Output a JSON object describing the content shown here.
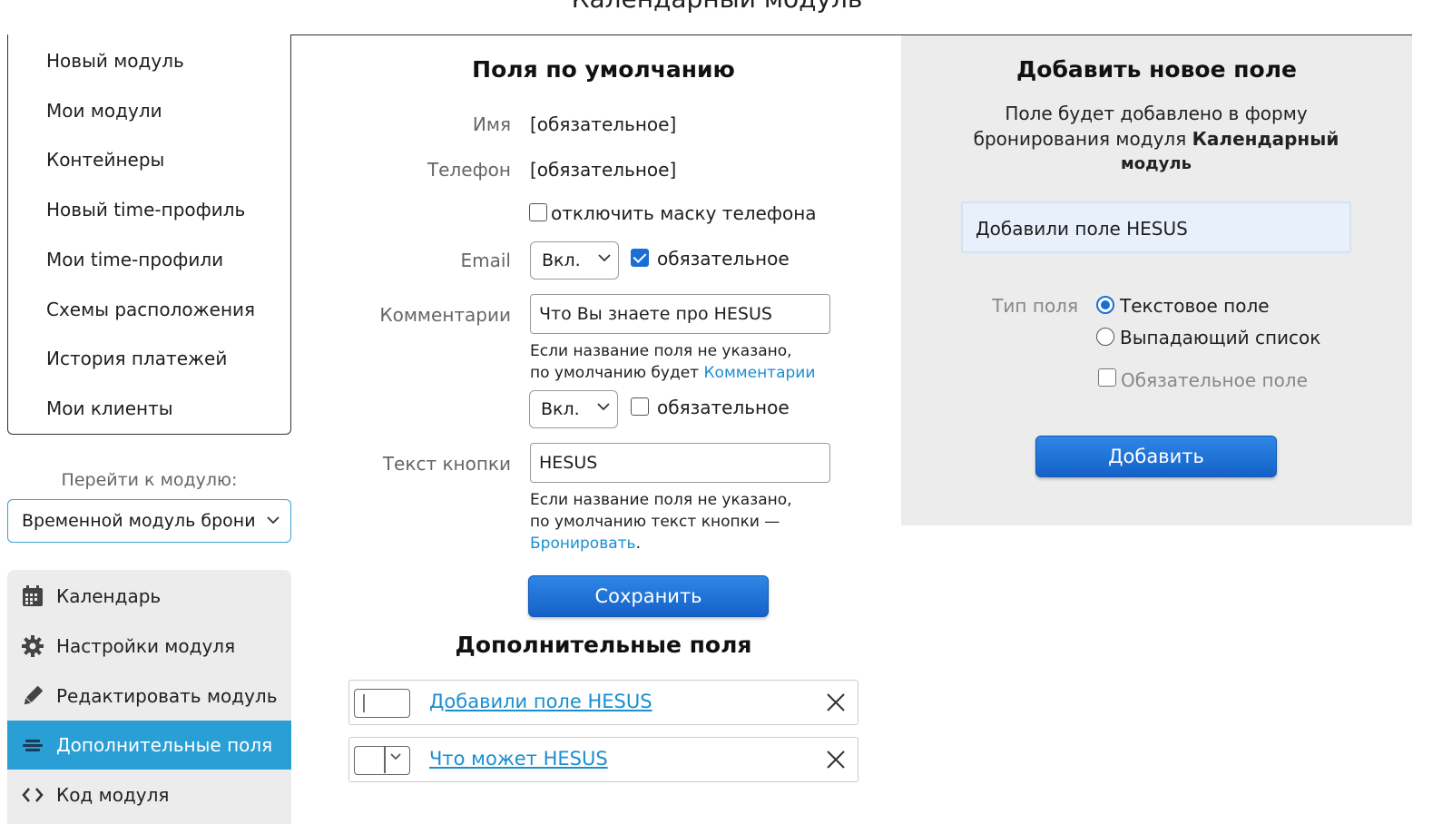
{
  "page_title": "Календарный модуль",
  "nav": {
    "items": [
      "Новый модуль",
      "Мои модули",
      "Контейнеры",
      "Новый time-профиль",
      "Мои time-профили",
      "Схемы расположения",
      "История платежей",
      "Мои клиенты"
    ]
  },
  "goto": {
    "label": "Перейти к модулю:",
    "selected": "Временной модуль брони"
  },
  "menu": {
    "items": [
      {
        "label": "Календарь",
        "icon": "calendar-icon"
      },
      {
        "label": "Настройки модуля",
        "icon": "gear-icon"
      },
      {
        "label": "Редактировать модуль",
        "icon": "pencil-icon"
      },
      {
        "label": "Дополнительные поля",
        "icon": "fields-icon",
        "active": true
      },
      {
        "label": "Код модуля",
        "icon": "code-icon"
      }
    ]
  },
  "defaults": {
    "title": "Поля по умолчанию",
    "name_label": "Имя",
    "name_value": "[обязательное]",
    "phone_label": "Телефон",
    "phone_value": "[обязательное]",
    "phone_mask_label": "отключить маску телефона",
    "email_label": "Email",
    "email_select": "Вкл.",
    "email_required_label": "обязательное",
    "comment_label": "Комментарии",
    "comment_value": "Что Вы знаете про HESUS",
    "comment_hint_line1": "Если название поля не указано,",
    "comment_hint_line2": "по умолчанию будет ",
    "comment_hint_link": "Комментарии",
    "comment_select": "Вкл.",
    "comment_required_label": "обязательное",
    "button_label": "Текст кнопки",
    "button_value": "HESUS",
    "button_hint_line1": "Если название поля не указано,",
    "button_hint_line2": "по умолчанию текст кнопки —",
    "button_hint_link": "Бронировать",
    "button_hint_end": ".",
    "save": "Сохранить"
  },
  "extra": {
    "title": "Дополнительные поля",
    "rows": [
      {
        "label": "Добавили поле HESUS",
        "type": "text"
      },
      {
        "label": "Что может HESUS",
        "type": "dropdown"
      }
    ]
  },
  "add_field": {
    "title": "Добавить новое поле",
    "desc_line1": "Поле будет добавлено в форму",
    "desc_line2": "бронирования модуля ",
    "desc_bold": "Календарный",
    "desc_line3": "модуль",
    "input_value": "Добавили поле HESUS",
    "type_label": "Тип поля",
    "option_text": "Текстовое поле",
    "option_dropdown": "Выпадающий список",
    "required_label": "Обязательное поле",
    "add_button": "Добавить"
  },
  "colors": {
    "accent": "#2a9fd6",
    "button": "#1a6fd6",
    "link": "#1a8fd0"
  }
}
